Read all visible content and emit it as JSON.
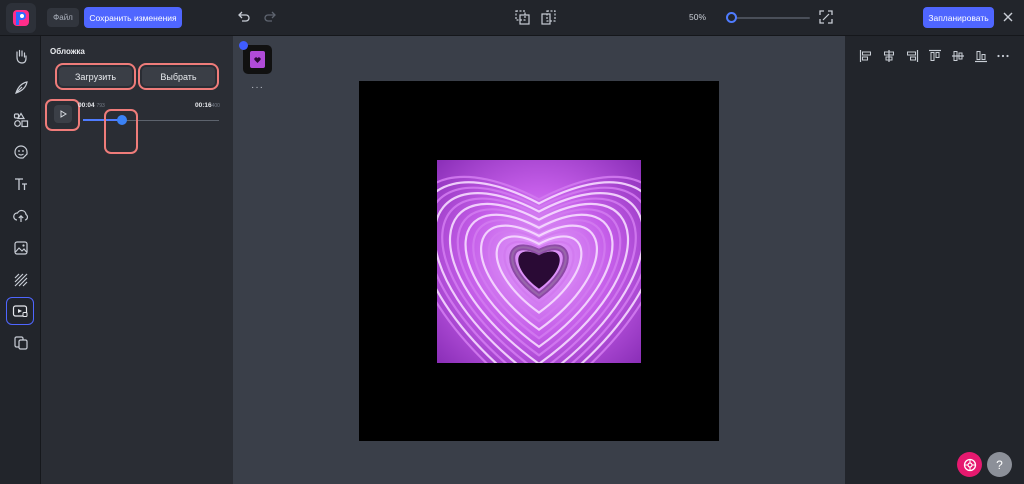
{
  "colors": {
    "accent": "#4f66ff",
    "highlight": "#ef7c7a",
    "canvas": "#000000",
    "art": "#c35ae8"
  },
  "topbar": {
    "file_label": "Файл",
    "save_label": "Сохранить изменения",
    "zoom_value": "50%",
    "zoom_level": 0.05,
    "schedule_label": "Запланировать"
  },
  "rail": {
    "icons": [
      "hand-icon",
      "feather-icon",
      "shapes-icon",
      "sticker-icon",
      "text-icon",
      "upload-icon",
      "image-icon",
      "pattern-icon",
      "video-icon",
      "copy-icon"
    ],
    "active_index": 8
  },
  "panel": {
    "title": "Обложка",
    "upload_label": "Загрузить",
    "choose_label": "Выбрать",
    "time_current": "00:04",
    "time_current_suffix": "793",
    "time_total": "00:16",
    "time_total_suffix": "400",
    "progress": 0.29
  },
  "workspace": {
    "more_label": "···"
  },
  "help": {
    "label": "?"
  }
}
